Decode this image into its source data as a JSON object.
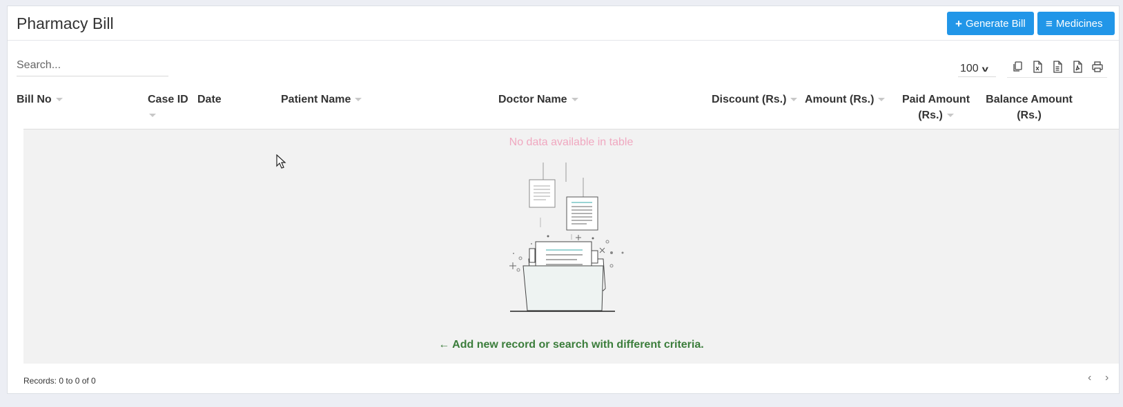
{
  "header": {
    "title": "Pharmacy Bill",
    "generate_bill_label": "Generate Bill",
    "medicines_label": "Medicines"
  },
  "toolbar": {
    "search_placeholder": "Search...",
    "page_length": "100",
    "export_icons": [
      "copy-icon",
      "excel-icon",
      "csv-icon",
      "pdf-icon",
      "print-icon"
    ]
  },
  "table": {
    "columns": [
      {
        "label": "Bill No",
        "sortable": true
      },
      {
        "label": "Case ID",
        "sortable": true
      },
      {
        "label": "Date",
        "sortable": false
      },
      {
        "label": "Patient Name",
        "sortable": true
      },
      {
        "label": "Doctor Name",
        "sortable": true
      },
      {
        "label": "Discount (Rs.)",
        "sortable": true
      },
      {
        "label": "Amount (Rs.)",
        "sortable": true
      },
      {
        "label": "Paid Amount (Rs.)",
        "sortable": true
      },
      {
        "label": "Balance Amount (Rs.)",
        "sortable": false
      }
    ],
    "rows": [],
    "empty_text": "No data available in table",
    "empty_hint": "Add new record or search with different criteria."
  },
  "footer": {
    "records": "Records: 0 to 0 of 0"
  },
  "colors": {
    "primary": "#2196e8",
    "empty_text": "#f0a8c0",
    "hint": "#3b7d3b"
  }
}
